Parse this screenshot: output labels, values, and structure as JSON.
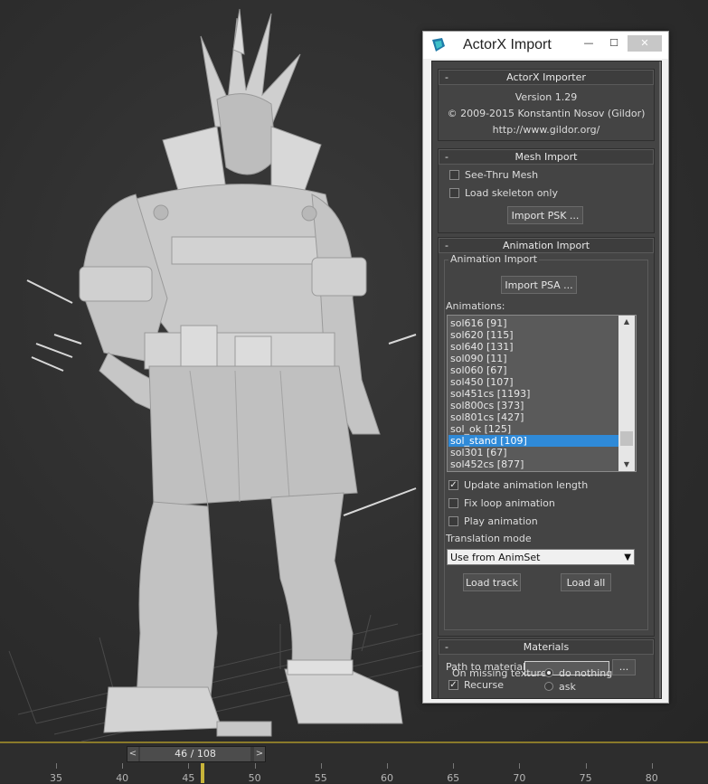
{
  "dialog": {
    "title": "ActorX Import",
    "min_label": "—",
    "max_label": "☐",
    "close_label": "✕"
  },
  "importer": {
    "header": "ActorX Importer",
    "version": "Version 1.29",
    "copyright": "© 2009-2015 Konstantin Nosov (Gildor)",
    "url": "http://www.gildor.org/"
  },
  "mesh": {
    "header": "Mesh Import",
    "see_thru": {
      "label": "See-Thru Mesh",
      "checked": false
    },
    "load_skeleton": {
      "label": "Load skeleton only",
      "checked": false
    },
    "import_button": "Import PSK ..."
  },
  "animation": {
    "header": "Animation Import",
    "group_label": "Animation Import",
    "import_button": "Import PSA ...",
    "list_label": "Animations:",
    "items": [
      "sol616 [91]",
      "sol620 [115]",
      "sol640 [131]",
      "sol090 [11]",
      "sol060 [67]",
      "sol450 [107]",
      "sol451cs [1193]",
      "sol800cs [373]",
      "sol801cs [427]",
      "sol_ok [125]",
      "sol_stand [109]",
      "sol301 [67]",
      "sol452cs [877]"
    ],
    "selected_index": 10,
    "update_length": {
      "label": "Update animation length",
      "checked": true
    },
    "fix_loop": {
      "label": "Fix loop animation",
      "checked": false
    },
    "play_anim": {
      "label": "Play animation",
      "checked": false
    },
    "translation_label": "Translation mode",
    "translation_value": "Use from AnimSet",
    "load_track": "Load track",
    "load_all": "Load all"
  },
  "materials": {
    "header": "Materials",
    "path_label": "Path to materials",
    "browse": "...",
    "recurse": {
      "label": "Recurse",
      "checked": true
    },
    "missing_label": "On missing texture:",
    "opt_nothing": "do nothing",
    "opt_ask": "ask",
    "selected": "do nothing"
  },
  "rollout_minus": "-",
  "timeline": {
    "frame_display": "46 / 108",
    "prev": "<",
    "next": ">",
    "ticks": [
      "35",
      "40",
      "45",
      "50",
      "55",
      "60",
      "65",
      "70",
      "75",
      "80"
    ],
    "current_frame": 46
  },
  "colors": {
    "viewport_bg": "#2e2e2e",
    "panel_bg": "#444444",
    "selection": "#2f8ad8",
    "playhead": "#c8b43a"
  }
}
